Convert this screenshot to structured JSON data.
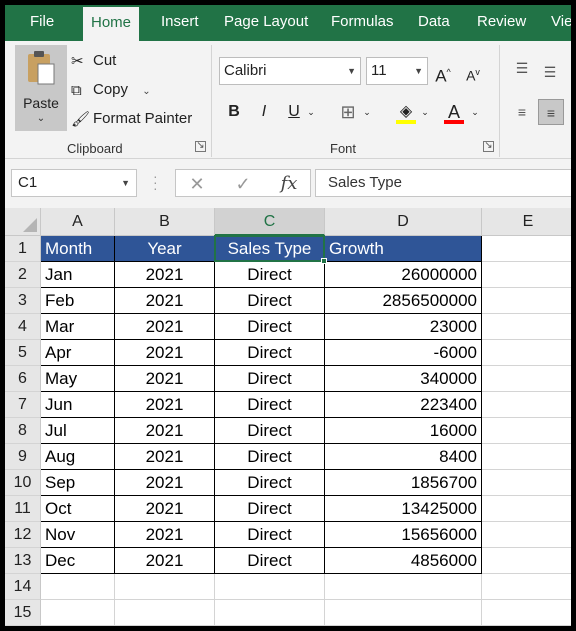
{
  "ribbon_tabs": [
    "File",
    "Home",
    "Insert",
    "Page Layout",
    "Formulas",
    "Data",
    "Review",
    "View"
  ],
  "active_tab": "Home",
  "clipboard": {
    "paste_label": "Paste",
    "cut_label": "Cut",
    "copy_label": "Copy",
    "format_painter_label": "Format Painter",
    "group_label": "Clipboard"
  },
  "font": {
    "family": "Calibri",
    "size": "11",
    "bold": "B",
    "italic": "I",
    "underline": "U",
    "grow": "A",
    "shrink": "A",
    "font_color": "A",
    "group_label": "Font",
    "fill_color": "#ffff00",
    "text_color": "#ff0000"
  },
  "formula_bar": {
    "name_box": "C1",
    "fx": "fx",
    "formula": "Sales Type"
  },
  "sheet": {
    "columns": [
      "A",
      "B",
      "C",
      "D",
      "E"
    ],
    "selected_column": "C",
    "row_numbers": [
      "1",
      "2",
      "3",
      "4",
      "5",
      "6",
      "7",
      "8",
      "9",
      "10",
      "11",
      "12",
      "13",
      "14",
      "15"
    ],
    "header": [
      "Month",
      "Year",
      "Sales Type",
      "Growth"
    ],
    "header_fill": "#2f5597",
    "rows": [
      [
        "Jan",
        "2021",
        "Direct",
        "26000000"
      ],
      [
        "Feb",
        "2021",
        "Direct",
        "2856500000"
      ],
      [
        "Mar",
        "2021",
        "Direct",
        "23000"
      ],
      [
        "Apr",
        "2021",
        "Direct",
        "-6000"
      ],
      [
        "May",
        "2021",
        "Direct",
        "340000"
      ],
      [
        "Jun",
        "2021",
        "Direct",
        "223400"
      ],
      [
        "Jul",
        "2021",
        "Direct",
        "16000"
      ],
      [
        "Aug",
        "2021",
        "Direct",
        "8400"
      ],
      [
        "Sep",
        "2021",
        "Direct",
        "1856700"
      ],
      [
        "Oct",
        "2021",
        "Direct",
        "13425000"
      ],
      [
        "Nov",
        "2021",
        "Direct",
        "15656000"
      ],
      [
        "Dec",
        "2021",
        "Direct",
        "4856000"
      ]
    ]
  }
}
